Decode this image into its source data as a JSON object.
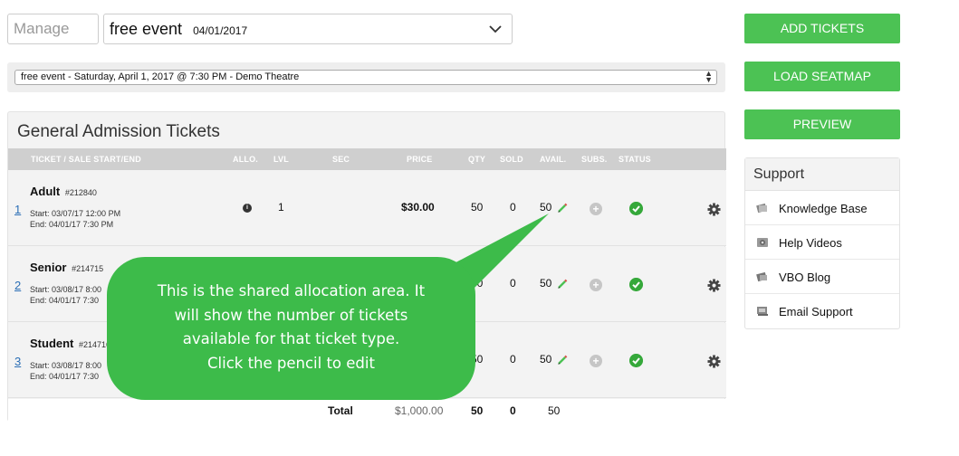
{
  "header": {
    "manage_placeholder": "Manage",
    "event_name": "free event",
    "event_date": "04/01/2017",
    "performance": "free event - Saturday, April 1, 2017 @ 7:30 PM - Demo Theatre"
  },
  "panel": {
    "title": "General Admission Tickets",
    "columns": [
      "TICKET / SALE START/END",
      "ALLO.",
      "LVL",
      "SEC",
      "PRICE",
      "QTY",
      "SOLD",
      "AVAIL.",
      "SUBS.",
      "STATUS"
    ]
  },
  "tickets": [
    {
      "num": "1",
      "name": "Adult",
      "id": "#212840",
      "start": "Start: 03/07/17 12:00 PM",
      "end": "End: 04/01/17 7:30 PM",
      "lvl": "1",
      "price": "$30.00",
      "qty": "50",
      "sold": "0",
      "avail": "50"
    },
    {
      "num": "2",
      "name": "Senior",
      "id": "#214715",
      "start": "Start: 03/08/17 8:00",
      "end": "End: 04/01/17 7:30",
      "lvl": "",
      "price": "",
      "qty": "50",
      "sold": "0",
      "avail": "50"
    },
    {
      "num": "3",
      "name": "Student",
      "id": "#214716",
      "start": "Start: 03/08/17 8:00",
      "end": "End: 04/01/17 7:30",
      "lvl": "",
      "price": "",
      "qty": "50",
      "sold": "0",
      "avail": "50"
    }
  ],
  "total": {
    "label": "Total",
    "price": "$1,000.00",
    "qty": "50",
    "sold": "0",
    "avail": "50"
  },
  "actions": {
    "add_tickets": "ADD TICKETS",
    "load_seatmap": "LOAD SEATMAP",
    "preview": "PREVIEW"
  },
  "support": {
    "title": "Support",
    "items": [
      {
        "label": "Knowledge Base",
        "icon": "book-icon"
      },
      {
        "label": "Help Videos",
        "icon": "video-icon"
      },
      {
        "label": "VBO Blog",
        "icon": "blog-icon"
      },
      {
        "label": "Email Support",
        "icon": "email-icon"
      }
    ]
  },
  "callout": {
    "line1": "This is the shared allocation area. It",
    "line2": "will show the number of tickets",
    "line3": "available for that ticket type.",
    "line4": "Click the pencil to edit"
  },
  "colors": {
    "green": "#4cc254",
    "callout": "#3dbb4a",
    "link": "#2a6eb5"
  }
}
